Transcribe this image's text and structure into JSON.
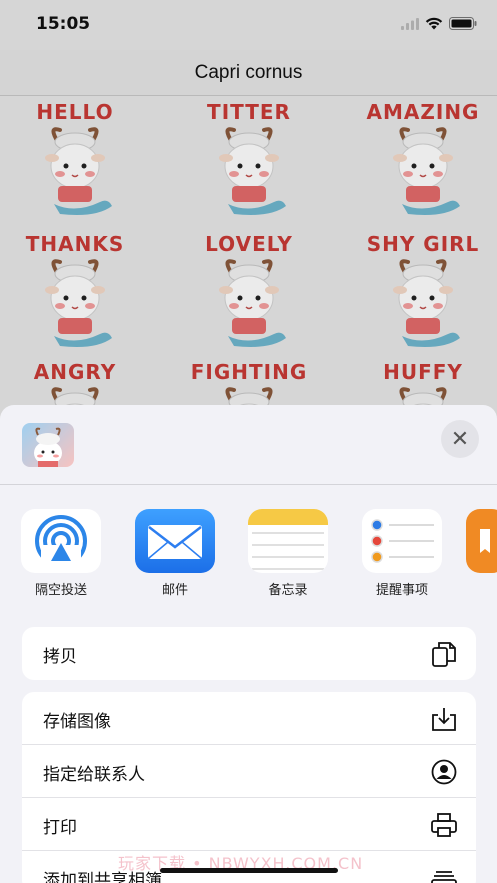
{
  "status_bar": {
    "time": "15:05"
  },
  "nav": {
    "title": "Capri cornus"
  },
  "stickers": [
    {
      "word": "HELLO"
    },
    {
      "word": "TITTER"
    },
    {
      "word": "AMAZING"
    },
    {
      "word": "THANKS"
    },
    {
      "word": "LOVELY"
    },
    {
      "word": "SHY GIRL"
    },
    {
      "word": "ANGRY"
    },
    {
      "word": "FIGHTING"
    },
    {
      "word": "HUFFY"
    }
  ],
  "share_sheet": {
    "close_symbol": "✕",
    "apps": [
      {
        "label": "隔空投送",
        "icon": "airdrop-icon"
      },
      {
        "label": "邮件",
        "icon": "mail-icon"
      },
      {
        "label": "备忘录",
        "icon": "notes-icon"
      },
      {
        "label": "提醒事项",
        "icon": "reminders-icon"
      }
    ],
    "group1": [
      {
        "label": "拷贝",
        "icon": "copy-icon"
      }
    ],
    "group2": [
      {
        "label": "存储图像",
        "icon": "save-image-icon"
      },
      {
        "label": "指定给联系人",
        "icon": "assign-contact-icon"
      },
      {
        "label": "打印",
        "icon": "print-icon"
      },
      {
        "label": "添加到共享相簿",
        "icon": "shared-album-icon"
      }
    ]
  },
  "watermark": "玩家下载 • NBWYXH.COM.CN",
  "colors": {
    "sticker_text": "#c93a36",
    "sheet_bg": "#f2f2f7",
    "mail_blue": "#2f7cf6"
  }
}
